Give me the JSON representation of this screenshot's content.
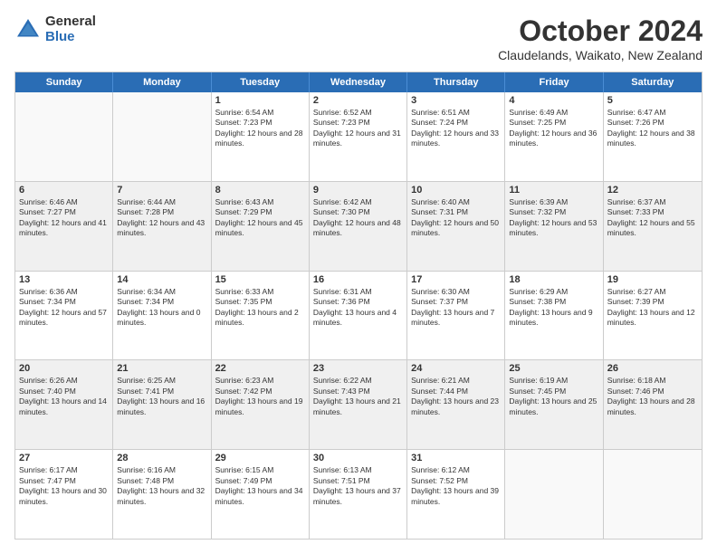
{
  "logo": {
    "general": "General",
    "blue": "Blue"
  },
  "title": "October 2024",
  "subtitle": "Claudelands, Waikato, New Zealand",
  "days": [
    "Sunday",
    "Monday",
    "Tuesday",
    "Wednesday",
    "Thursday",
    "Friday",
    "Saturday"
  ],
  "weeks": [
    [
      {
        "day": "",
        "sunrise": "",
        "sunset": "",
        "daylight": "",
        "empty": true
      },
      {
        "day": "",
        "sunrise": "",
        "sunset": "",
        "daylight": "",
        "empty": true
      },
      {
        "day": "1",
        "sunrise": "Sunrise: 6:54 AM",
        "sunset": "Sunset: 7:23 PM",
        "daylight": "Daylight: 12 hours and 28 minutes.",
        "empty": false
      },
      {
        "day": "2",
        "sunrise": "Sunrise: 6:52 AM",
        "sunset": "Sunset: 7:23 PM",
        "daylight": "Daylight: 12 hours and 31 minutes.",
        "empty": false
      },
      {
        "day": "3",
        "sunrise": "Sunrise: 6:51 AM",
        "sunset": "Sunset: 7:24 PM",
        "daylight": "Daylight: 12 hours and 33 minutes.",
        "empty": false
      },
      {
        "day": "4",
        "sunrise": "Sunrise: 6:49 AM",
        "sunset": "Sunset: 7:25 PM",
        "daylight": "Daylight: 12 hours and 36 minutes.",
        "empty": false
      },
      {
        "day": "5",
        "sunrise": "Sunrise: 6:47 AM",
        "sunset": "Sunset: 7:26 PM",
        "daylight": "Daylight: 12 hours and 38 minutes.",
        "empty": false
      }
    ],
    [
      {
        "day": "6",
        "sunrise": "Sunrise: 6:46 AM",
        "sunset": "Sunset: 7:27 PM",
        "daylight": "Daylight: 12 hours and 41 minutes.",
        "empty": false
      },
      {
        "day": "7",
        "sunrise": "Sunrise: 6:44 AM",
        "sunset": "Sunset: 7:28 PM",
        "daylight": "Daylight: 12 hours and 43 minutes.",
        "empty": false
      },
      {
        "day": "8",
        "sunrise": "Sunrise: 6:43 AM",
        "sunset": "Sunset: 7:29 PM",
        "daylight": "Daylight: 12 hours and 45 minutes.",
        "empty": false
      },
      {
        "day": "9",
        "sunrise": "Sunrise: 6:42 AM",
        "sunset": "Sunset: 7:30 PM",
        "daylight": "Daylight: 12 hours and 48 minutes.",
        "empty": false
      },
      {
        "day": "10",
        "sunrise": "Sunrise: 6:40 AM",
        "sunset": "Sunset: 7:31 PM",
        "daylight": "Daylight: 12 hours and 50 minutes.",
        "empty": false
      },
      {
        "day": "11",
        "sunrise": "Sunrise: 6:39 AM",
        "sunset": "Sunset: 7:32 PM",
        "daylight": "Daylight: 12 hours and 53 minutes.",
        "empty": false
      },
      {
        "day": "12",
        "sunrise": "Sunrise: 6:37 AM",
        "sunset": "Sunset: 7:33 PM",
        "daylight": "Daylight: 12 hours and 55 minutes.",
        "empty": false
      }
    ],
    [
      {
        "day": "13",
        "sunrise": "Sunrise: 6:36 AM",
        "sunset": "Sunset: 7:34 PM",
        "daylight": "Daylight: 12 hours and 57 minutes.",
        "empty": false
      },
      {
        "day": "14",
        "sunrise": "Sunrise: 6:34 AM",
        "sunset": "Sunset: 7:34 PM",
        "daylight": "Daylight: 13 hours and 0 minutes.",
        "empty": false
      },
      {
        "day": "15",
        "sunrise": "Sunrise: 6:33 AM",
        "sunset": "Sunset: 7:35 PM",
        "daylight": "Daylight: 13 hours and 2 minutes.",
        "empty": false
      },
      {
        "day": "16",
        "sunrise": "Sunrise: 6:31 AM",
        "sunset": "Sunset: 7:36 PM",
        "daylight": "Daylight: 13 hours and 4 minutes.",
        "empty": false
      },
      {
        "day": "17",
        "sunrise": "Sunrise: 6:30 AM",
        "sunset": "Sunset: 7:37 PM",
        "daylight": "Daylight: 13 hours and 7 minutes.",
        "empty": false
      },
      {
        "day": "18",
        "sunrise": "Sunrise: 6:29 AM",
        "sunset": "Sunset: 7:38 PM",
        "daylight": "Daylight: 13 hours and 9 minutes.",
        "empty": false
      },
      {
        "day": "19",
        "sunrise": "Sunrise: 6:27 AM",
        "sunset": "Sunset: 7:39 PM",
        "daylight": "Daylight: 13 hours and 12 minutes.",
        "empty": false
      }
    ],
    [
      {
        "day": "20",
        "sunrise": "Sunrise: 6:26 AM",
        "sunset": "Sunset: 7:40 PM",
        "daylight": "Daylight: 13 hours and 14 minutes.",
        "empty": false
      },
      {
        "day": "21",
        "sunrise": "Sunrise: 6:25 AM",
        "sunset": "Sunset: 7:41 PM",
        "daylight": "Daylight: 13 hours and 16 minutes.",
        "empty": false
      },
      {
        "day": "22",
        "sunrise": "Sunrise: 6:23 AM",
        "sunset": "Sunset: 7:42 PM",
        "daylight": "Daylight: 13 hours and 19 minutes.",
        "empty": false
      },
      {
        "day": "23",
        "sunrise": "Sunrise: 6:22 AM",
        "sunset": "Sunset: 7:43 PM",
        "daylight": "Daylight: 13 hours and 21 minutes.",
        "empty": false
      },
      {
        "day": "24",
        "sunrise": "Sunrise: 6:21 AM",
        "sunset": "Sunset: 7:44 PM",
        "daylight": "Daylight: 13 hours and 23 minutes.",
        "empty": false
      },
      {
        "day": "25",
        "sunrise": "Sunrise: 6:19 AM",
        "sunset": "Sunset: 7:45 PM",
        "daylight": "Daylight: 13 hours and 25 minutes.",
        "empty": false
      },
      {
        "day": "26",
        "sunrise": "Sunrise: 6:18 AM",
        "sunset": "Sunset: 7:46 PM",
        "daylight": "Daylight: 13 hours and 28 minutes.",
        "empty": false
      }
    ],
    [
      {
        "day": "27",
        "sunrise": "Sunrise: 6:17 AM",
        "sunset": "Sunset: 7:47 PM",
        "daylight": "Daylight: 13 hours and 30 minutes.",
        "empty": false
      },
      {
        "day": "28",
        "sunrise": "Sunrise: 6:16 AM",
        "sunset": "Sunset: 7:48 PM",
        "daylight": "Daylight: 13 hours and 32 minutes.",
        "empty": false
      },
      {
        "day": "29",
        "sunrise": "Sunrise: 6:15 AM",
        "sunset": "Sunset: 7:49 PM",
        "daylight": "Daylight: 13 hours and 34 minutes.",
        "empty": false
      },
      {
        "day": "30",
        "sunrise": "Sunrise: 6:13 AM",
        "sunset": "Sunset: 7:51 PM",
        "daylight": "Daylight: 13 hours and 37 minutes.",
        "empty": false
      },
      {
        "day": "31",
        "sunrise": "Sunrise: 6:12 AM",
        "sunset": "Sunset: 7:52 PM",
        "daylight": "Daylight: 13 hours and 39 minutes.",
        "empty": false
      },
      {
        "day": "",
        "sunrise": "",
        "sunset": "",
        "daylight": "",
        "empty": true
      },
      {
        "day": "",
        "sunrise": "",
        "sunset": "",
        "daylight": "",
        "empty": true
      }
    ]
  ]
}
